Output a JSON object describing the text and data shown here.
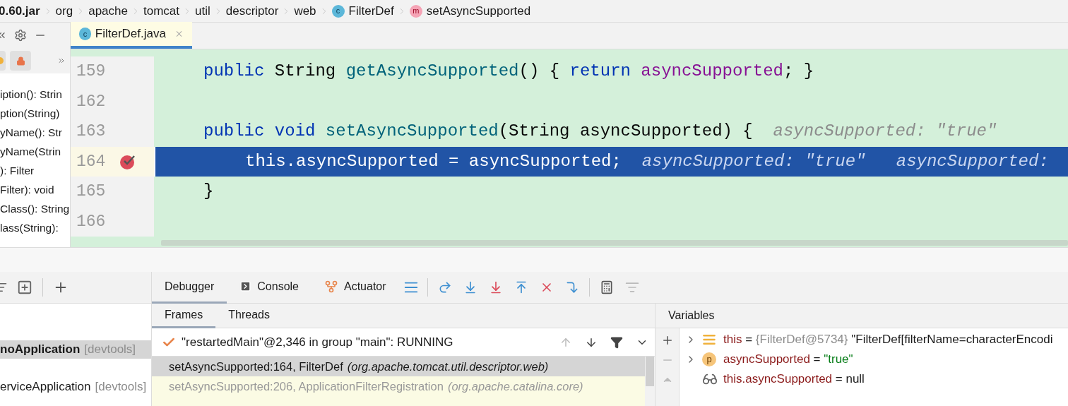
{
  "breadcrumb": [
    {
      "label": "0.60.jar",
      "kind": "jar"
    },
    {
      "label": "org",
      "kind": "package"
    },
    {
      "label": "apache",
      "kind": "package"
    },
    {
      "label": "tomcat",
      "kind": "package"
    },
    {
      "label": "util",
      "kind": "package"
    },
    {
      "label": "descriptor",
      "kind": "package"
    },
    {
      "label": "web",
      "kind": "package"
    },
    {
      "label": "FilterDef",
      "kind": "class",
      "icon_letter": "c"
    },
    {
      "label": "setAsyncSupported",
      "kind": "method",
      "icon_letter": "m"
    }
  ],
  "structure": {
    "items": [
      "iption(): Strin",
      "ption(String)",
      "yName(): Str",
      "yName(Strin",
      "): Filter",
      "Filter): void",
      "Class(): String",
      "lass(String):"
    ]
  },
  "editor": {
    "tab": {
      "label": "FilterDef.java",
      "icon_letter": "c",
      "selected": true
    },
    "lines": [
      {
        "number": "159",
        "kind": "member",
        "current": false,
        "breakpoint": false,
        "tokens": [
          {
            "kind": "keyword",
            "text": "public "
          },
          {
            "kind": "plain",
            "text": "String "
          },
          {
            "kind": "method",
            "text": "getAsyncSupported"
          },
          {
            "kind": "plain",
            "text": "() { "
          },
          {
            "kind": "keyword",
            "text": "return "
          },
          {
            "kind": "field",
            "text": "asyncSupported"
          },
          {
            "kind": "plain",
            "text": "; }"
          }
        ]
      },
      {
        "number": "162",
        "kind": "blank",
        "current": false,
        "breakpoint": false
      },
      {
        "number": "163",
        "kind": "member",
        "current": false,
        "breakpoint": false,
        "tokens": [
          {
            "kind": "keyword",
            "text": "public "
          },
          {
            "kind": "keyword",
            "text": "void "
          },
          {
            "kind": "method",
            "text": "setAsyncSupported"
          },
          {
            "kind": "plain",
            "text": "(String asyncSupported) {"
          },
          {
            "kind": "hint",
            "text": "asyncSupported: \"true\""
          }
        ]
      },
      {
        "number": "164",
        "kind": "body",
        "current": true,
        "breakpoint": true,
        "tokens": [
          {
            "kind": "plain",
            "text": "this.asyncSupported = asyncSupported;"
          },
          {
            "kind": "hint",
            "text": "asyncSupported: \"true\""
          },
          {
            "kind": "hint",
            "text": "asyncSupported:"
          }
        ]
      },
      {
        "number": "165",
        "kind": "member",
        "current": false,
        "breakpoint": false,
        "tokens": [
          {
            "kind": "plain",
            "text": "}"
          }
        ]
      },
      {
        "number": "166",
        "kind": "blank",
        "current": false,
        "breakpoint": false
      }
    ]
  },
  "services": {
    "rows": [
      {
        "name": "noApplication",
        "tag": "[devtools]",
        "selected": true
      },
      {
        "name": "erviceApplication",
        "tag": "[devtools]",
        "selected": false
      }
    ]
  },
  "debug_tabs": [
    {
      "label": "Debugger",
      "kind": "debugger",
      "selected": true
    },
    {
      "label": "Console",
      "kind": "console",
      "selected": false
    },
    {
      "label": "Actuator",
      "kind": "actuator",
      "selected": false
    }
  ],
  "frames_tabs": [
    {
      "label": "Frames",
      "selected": true
    },
    {
      "label": "Threads",
      "selected": false
    }
  ],
  "thread": {
    "value": "\"restartedMain\"@2,346 in group \"main\": RUNNING"
  },
  "frames": [
    {
      "method": "setAsyncSupported:164, FilterDef",
      "package": "(org.apache.tomcat.util.descriptor.web)",
      "selected": true,
      "library": false
    },
    {
      "method": "setAsyncSupported:206, ApplicationFilterRegistration",
      "package": "(org.apache.catalina.core)",
      "selected": false,
      "library": true
    }
  ],
  "variables": {
    "title": "Variables",
    "rows": [
      {
        "kind": "field",
        "expandable": true,
        "name": "this",
        "equals": " = ",
        "ref": "{FilterDef@5734}",
        "value": "\"FilterDef[filterName=characterEncodi",
        "value_is_string": false
      },
      {
        "kind": "param",
        "icon_letter": "p",
        "expandable": true,
        "name": "asyncSupported",
        "equals": " = ",
        "value": "\"true\"",
        "value_is_string": true
      },
      {
        "kind": "watch",
        "expandable": false,
        "name": "this.asyncSupported",
        "equals": " = ",
        "value": "null",
        "value_is_string": false
      }
    ]
  }
}
